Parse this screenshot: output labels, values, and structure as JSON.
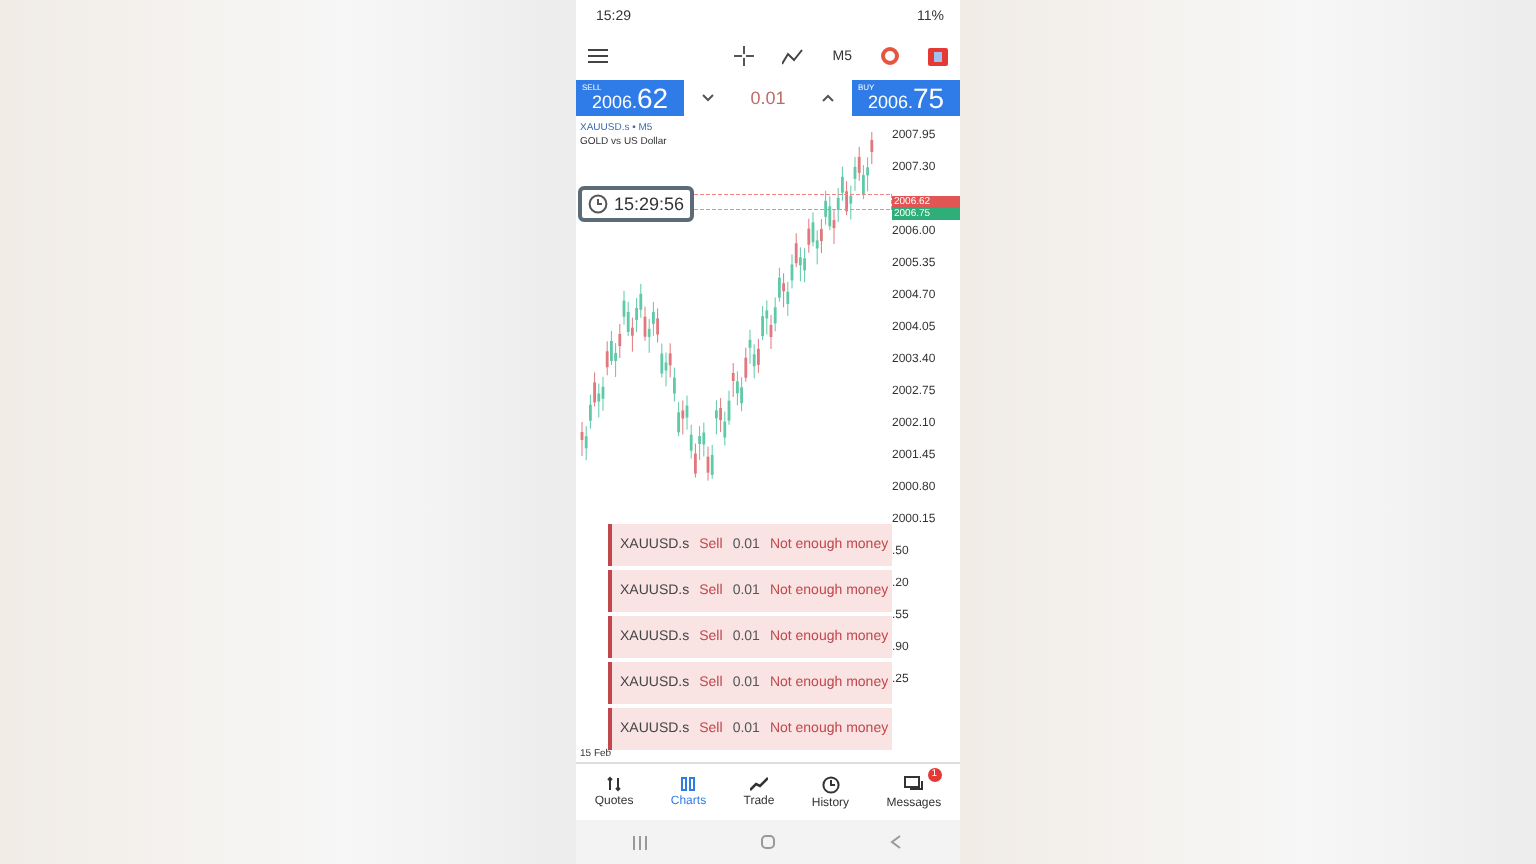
{
  "status_bar": {
    "time": "15:29",
    "battery": "11%"
  },
  "toolbar": {
    "timeframe": "M5"
  },
  "trade_bar": {
    "sell": {
      "label": "SELL",
      "price": "2006.**62**"
    },
    "lot": "0.01",
    "buy": {
      "label": "BUY",
      "price": "2006.**75**"
    }
  },
  "chart": {
    "symbol": "XAUUSD.s • M5",
    "description": "GOLD vs US Dollar",
    "timer": "15:29:56",
    "bid_badge": "2006.62",
    "ask_badge": "2006.75",
    "axis_labels": [
      "2007.95",
      "2007.30",
      "2006.00",
      "2005.35",
      "2004.70",
      "2004.05",
      "2003.40",
      "2002.75",
      "2002.10",
      "2001.45",
      "2000.80",
      "2000.15",
      ".50",
      ".20",
      ".55",
      ".90",
      ".25"
    ],
    "date_label": "15 Feb"
  },
  "alerts": [
    {
      "symbol": "XAUUSD.s",
      "side": "Sell",
      "volume": "0.01",
      "message": "Not enough money"
    },
    {
      "symbol": "XAUUSD.s",
      "side": "Sell",
      "volume": "0.01",
      "message": "Not enough money"
    },
    {
      "symbol": "XAUUSD.s",
      "side": "Sell",
      "volume": "0.01",
      "message": "Not enough money"
    },
    {
      "symbol": "XAUUSD.s",
      "side": "Sell",
      "volume": "0.01",
      "message": "Not enough money"
    },
    {
      "symbol": "XAUUSD.s",
      "side": "Sell",
      "volume": "0.01",
      "message": "Not enough money"
    }
  ],
  "bottom_nav": [
    {
      "kind": "quotes",
      "label": "Quotes",
      "selected": false
    },
    {
      "kind": "charts",
      "label": "Charts",
      "selected": true
    },
    {
      "kind": "trade",
      "label": "Trade",
      "selected": false
    },
    {
      "kind": "history",
      "label": "History",
      "selected": false
    },
    {
      "kind": "messages",
      "label": "Messages",
      "selected": false,
      "badge": "1"
    }
  ]
}
